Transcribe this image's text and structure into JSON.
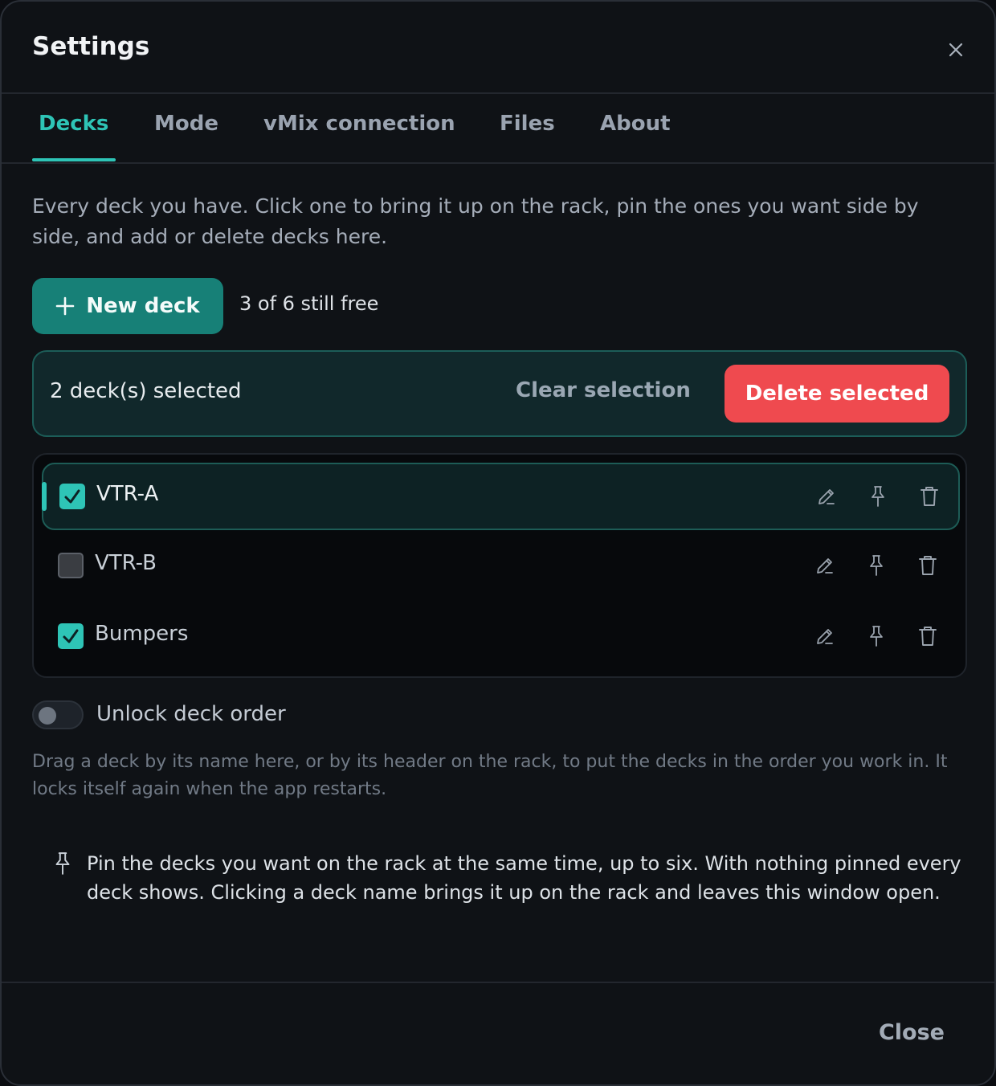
{
  "dialog": {
    "title": "Settings",
    "close_icon": "close-icon"
  },
  "tabs": [
    {
      "label": "Decks",
      "active": true
    },
    {
      "label": "Mode",
      "active": false
    },
    {
      "label": "vMix connection",
      "active": false
    },
    {
      "label": "Files",
      "active": false
    },
    {
      "label": "About",
      "active": false
    }
  ],
  "decks_panel": {
    "intro": "Every deck you have. Click one to bring it up on the rack, pin the ones you want side by side, and add or delete decks here.",
    "new_deck_label": "New deck",
    "free_text": "3 of 6 still free",
    "selection": {
      "count_text": "2 deck(s) selected",
      "clear_label": "Clear selection",
      "delete_label": "Delete selected"
    },
    "decks": [
      {
        "name": "VTR-A",
        "checked": true,
        "highlighted": true
      },
      {
        "name": "VTR-B",
        "checked": false,
        "highlighted": false
      },
      {
        "name": "Bumpers",
        "checked": true,
        "highlighted": false
      }
    ],
    "unlock_order": {
      "label": "Unlock deck order",
      "on": false,
      "hint": "Drag a deck by its name here, or by its header on the rack, to put the decks in the order you work in. It locks itself again when the app restarts."
    },
    "pin_note": "Pin the decks you want on the rack at the same time, up to six. With nothing pinned every deck shows. Clicking a deck name brings it up on the rack and leaves this window open."
  },
  "footer": {
    "close_label": "Close"
  },
  "colors": {
    "accent": "#2ec4b6",
    "primary_button": "#178077",
    "danger": "#ef4a4f"
  }
}
